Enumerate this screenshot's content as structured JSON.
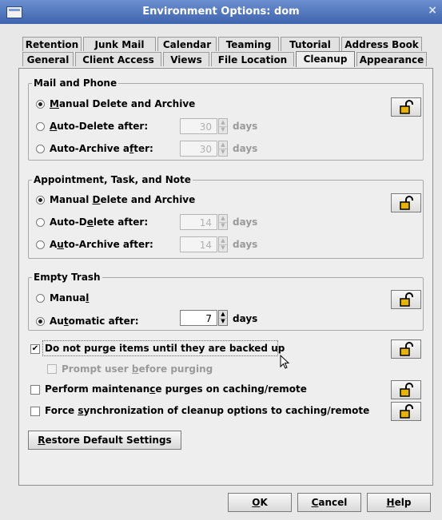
{
  "window": {
    "title": "Environment Options:  dom",
    "close_glyph": "×"
  },
  "tabs": {
    "row_back": [
      "Retention",
      "Junk Mail",
      "Calendar",
      "Teaming",
      "Tutorial",
      "Address Book"
    ],
    "row_front": [
      "General",
      "Client Access",
      "Views",
      "File Location",
      "Cleanup",
      "Appearance"
    ],
    "active": "Cleanup"
  },
  "mail_phone": {
    "legend": "Mail and Phone",
    "manual": {
      "pre": "",
      "u": "M",
      "post": "anual Delete and Archive",
      "selected": true
    },
    "auto_delete": {
      "pre": "",
      "u": "A",
      "post": "uto-Delete after:",
      "value": "30",
      "unit": "days"
    },
    "auto_archive": {
      "pre": "Auto-Archive a",
      "u": "f",
      "post": "ter:",
      "value": "30",
      "unit": "days"
    }
  },
  "appointment": {
    "legend": "Appointment, Task, and Note",
    "manual": {
      "pre": "Manual ",
      "u": "D",
      "post": "elete and Archive",
      "selected": true
    },
    "auto_delete": {
      "pre": "Auto-D",
      "u": "e",
      "post": "lete after:",
      "value": "14",
      "unit": "days"
    },
    "auto_archive": {
      "pre": "A",
      "u": "u",
      "post": "to-Archive after:",
      "value": "14",
      "unit": "days"
    }
  },
  "empty_trash": {
    "legend": "Empty Trash",
    "manual": {
      "pre": "Manua",
      "u": "l",
      "post": ""
    },
    "automatic": {
      "pre": "Au",
      "u": "t",
      "post": "omatic after:",
      "value": "7",
      "unit": "days",
      "selected": true
    }
  },
  "options": {
    "no_purge": {
      "label": "Do not purge items until they are backed up",
      "checked": true
    },
    "prompt_user": {
      "pre": "Prompt user ",
      "u": "b",
      "post": "efore purging",
      "checked": false
    },
    "maintenance": {
      "pre": "Perform maintenan",
      "u": "c",
      "post": "e purges on caching/remote",
      "checked": false
    },
    "force_sync": {
      "pre": "Force ",
      "u": "s",
      "post": "ynchronization of cleanup options to caching/remote",
      "checked": false
    }
  },
  "restore_button": {
    "pre": "",
    "u": "R",
    "post": "estore Default Settings"
  },
  "footer": {
    "ok": {
      "u": "O",
      "post": "K"
    },
    "cancel": {
      "u": "C",
      "post": "ancel"
    },
    "help": {
      "u": "H",
      "post": "elp"
    }
  },
  "colors": {
    "titlebar": "#4f74bd",
    "lock": "#e8b400",
    "panel": "#eeeeee"
  }
}
